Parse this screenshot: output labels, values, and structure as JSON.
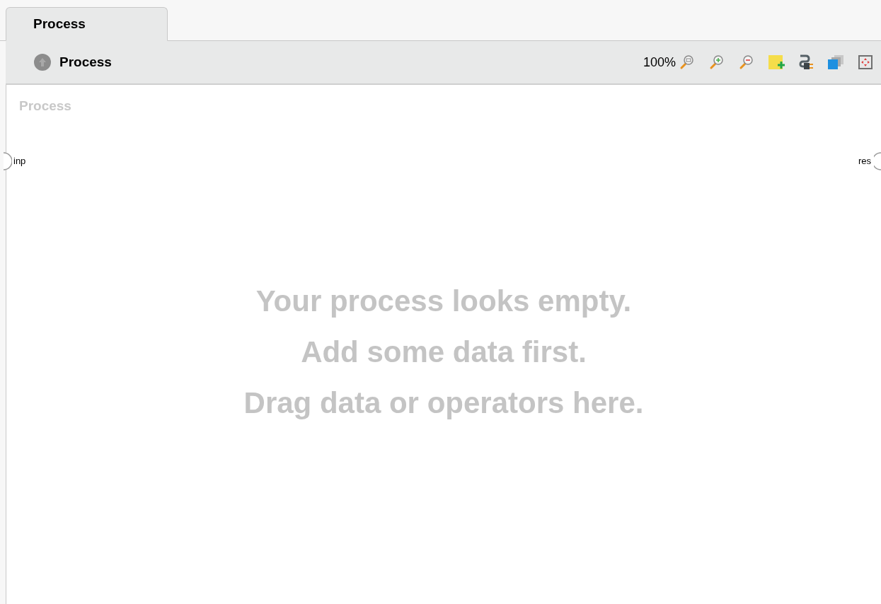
{
  "tabs": [
    {
      "label": "Process",
      "selected": true
    }
  ],
  "toolbar": {
    "breadcrumb": "Process",
    "zoom": "100%"
  },
  "canvas": {
    "title": "Process",
    "input_port": "inp",
    "output_port": "res",
    "empty_message": [
      "Your process looks empty.",
      "Add some data first.",
      "Drag data or operators here."
    ]
  }
}
